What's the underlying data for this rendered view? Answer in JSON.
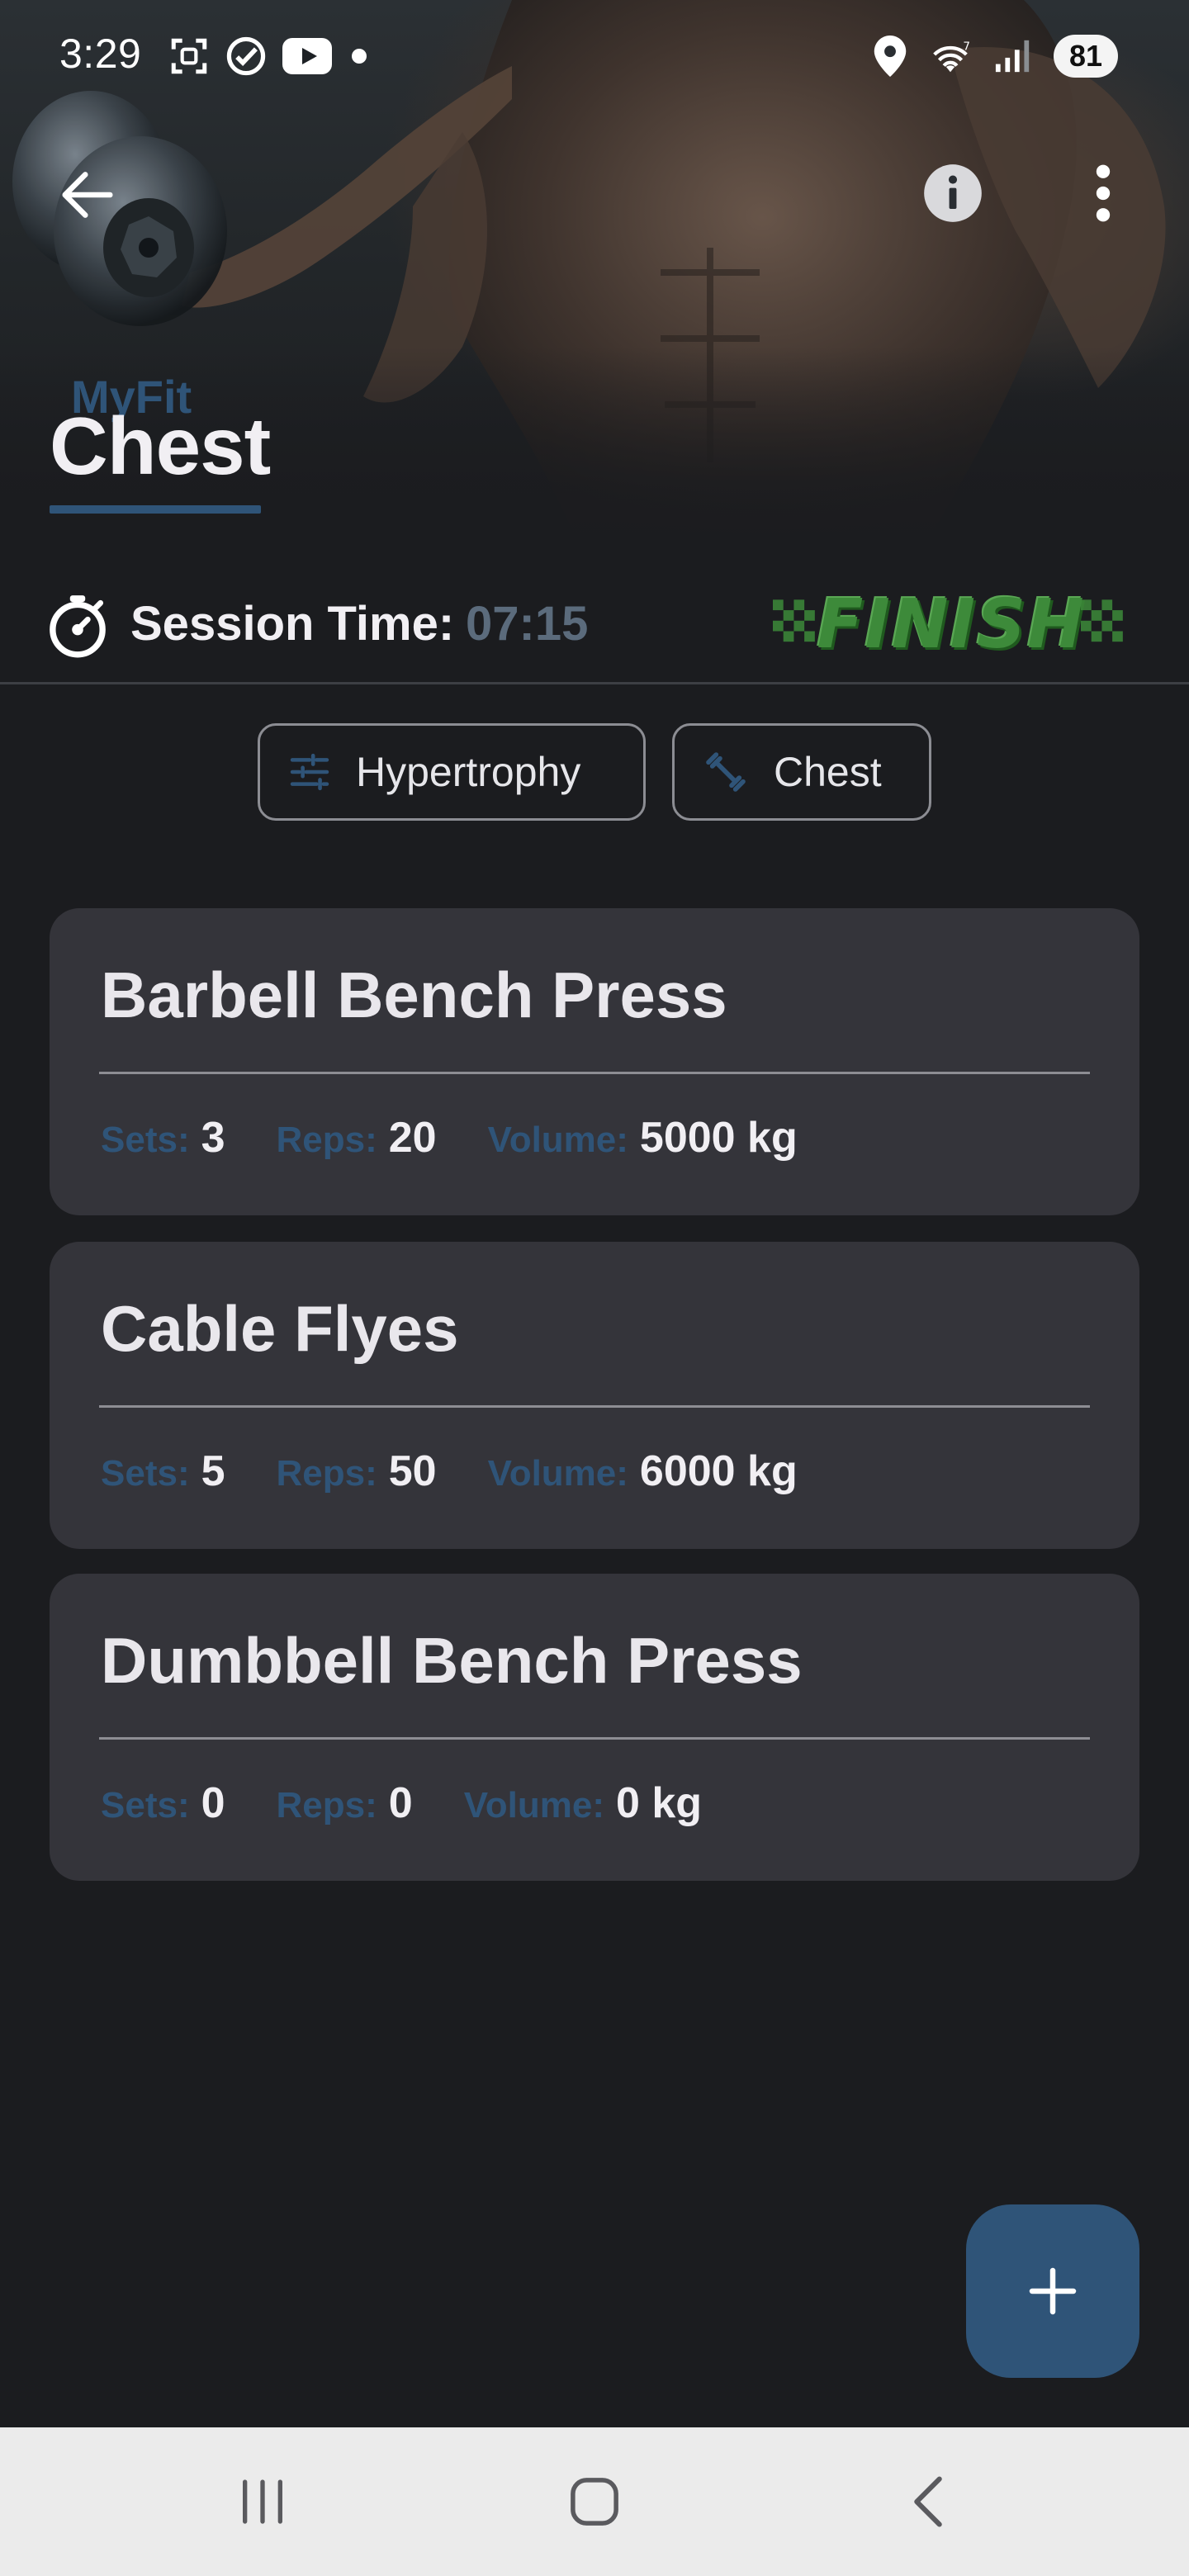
{
  "status_bar": {
    "time": "3:29",
    "battery": "81",
    "icons": [
      "screenshot-icon",
      "check-circle-icon",
      "youtube-icon",
      "dot-icon",
      "location-icon",
      "wifi-icon",
      "signal-icon"
    ]
  },
  "app_bar": {
    "app_name": "MyFit",
    "title": "Chest",
    "back_icon": "arrow-back-icon",
    "info_icon": "info-icon",
    "more_icon": "more-vert-icon"
  },
  "session": {
    "label": "Session Time:",
    "time": "07:15",
    "finish_label": "FINISH"
  },
  "filters": {
    "goal": {
      "label": "Hypertrophy",
      "icon": "tune-icon"
    },
    "muscle": {
      "label": "Chest",
      "icon": "dumbbell-icon"
    }
  },
  "exercises": [
    {
      "name": "Barbell Bench Press",
      "sets_label": "Sets:",
      "sets": "3",
      "reps_label": "Reps:",
      "reps": "20",
      "volume_label": "Volume:",
      "volume": "5000 kg"
    },
    {
      "name": "Cable Flyes",
      "sets_label": "Sets:",
      "sets": "5",
      "reps_label": "Reps:",
      "reps": "50",
      "volume_label": "Volume:",
      "volume": "6000 kg"
    },
    {
      "name": "Dumbbell Bench Press",
      "sets_label": "Sets:",
      "sets": "0",
      "reps_label": "Reps:",
      "reps": "0",
      "volume_label": "Volume:",
      "volume": "0 kg"
    }
  ],
  "fab": {
    "icon": "plus-icon"
  },
  "nav": {
    "icons": [
      "recents-icon",
      "home-icon",
      "back-icon"
    ]
  },
  "colors": {
    "accent": "#2f5478",
    "background": "#1b1c1f",
    "card": "#34343a",
    "finish_green": "#3d8a3a"
  }
}
